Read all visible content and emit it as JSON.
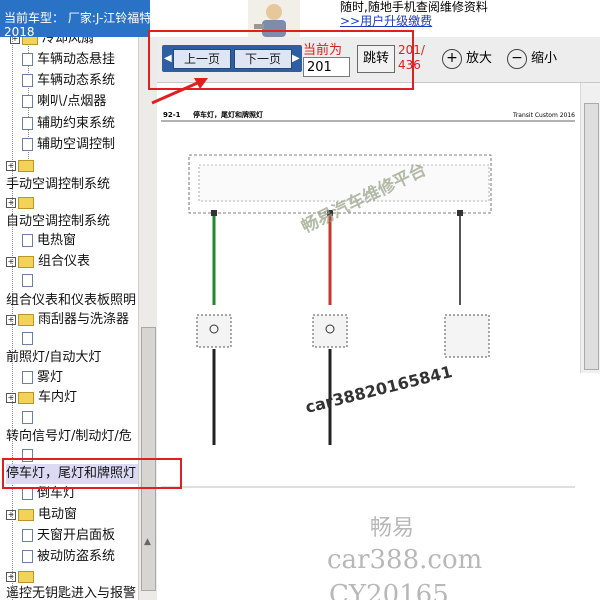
{
  "header": {
    "car_label": "当前车型：  厂家:J-江铃福特全顺（Transit）",
    "car_year": "2018",
    "notice_line1": "随时,随地手机查阅维修资料",
    "notice_link": ">>用户升级缴费"
  },
  "tree": {
    "items": [
      {
        "label": "冷却风扇",
        "type": "folder"
      },
      {
        "label": "车辆动态悬挂",
        "type": "page"
      },
      {
        "label": "车辆动态系统",
        "type": "page"
      },
      {
        "label": "喇叭/点烟器",
        "type": "page"
      },
      {
        "label": "辅助约束系统",
        "type": "page"
      },
      {
        "label": "辅助空调控制",
        "type": "page"
      },
      {
        "label": "手动空调控制系统",
        "type": "top"
      },
      {
        "label": "自动空调控制系统",
        "type": "top"
      },
      {
        "label": "电热窗",
        "type": "page"
      },
      {
        "label": "组合仪表",
        "type": "folder"
      },
      {
        "label": "组合仪表和仪表板照明",
        "type": "top"
      },
      {
        "label": "雨刮器与洗涤器",
        "type": "folder"
      },
      {
        "label": "前照灯/自动大灯",
        "type": "top"
      },
      {
        "label": "雾灯",
        "type": "page"
      },
      {
        "label": "车内灯",
        "type": "folder"
      },
      {
        "label": "转向信号灯/制动灯/危",
        "type": "top"
      },
      {
        "label": "停车灯，尾灯和牌照灯",
        "type": "selected"
      },
      {
        "label": "倒车灯",
        "type": "page"
      },
      {
        "label": "电动窗",
        "type": "folder"
      },
      {
        "label": "天窗开启面板",
        "type": "page"
      },
      {
        "label": "被动防盗系统",
        "type": "page"
      },
      {
        "label": "遥控无钥匙进入与报警",
        "type": "top"
      }
    ]
  },
  "toolbar": {
    "prev_label": "上一页",
    "next_label": "下一页",
    "current_label": "当前为",
    "page_value": "201",
    "jump_label": "跳转",
    "total_num": "201/",
    "total_den": "436",
    "zoom_in_label": "放大",
    "zoom_out_label": "缩小"
  },
  "diagram": {
    "section_code": "92-1",
    "section_title": "停车灯，尾灯和牌照灯",
    "model": "Transit Custom 2016",
    "wm_main": "畅易汽车维修平台",
    "wm_phone": "car38820165841",
    "wm_brand": "畅易",
    "wm_site": "car388.com",
    "wm_code": "CY20165"
  },
  "colors": {
    "accent": "#2f5fa3",
    "annotation": "#e02020",
    "selected_bg": "#dcd9f4"
  }
}
